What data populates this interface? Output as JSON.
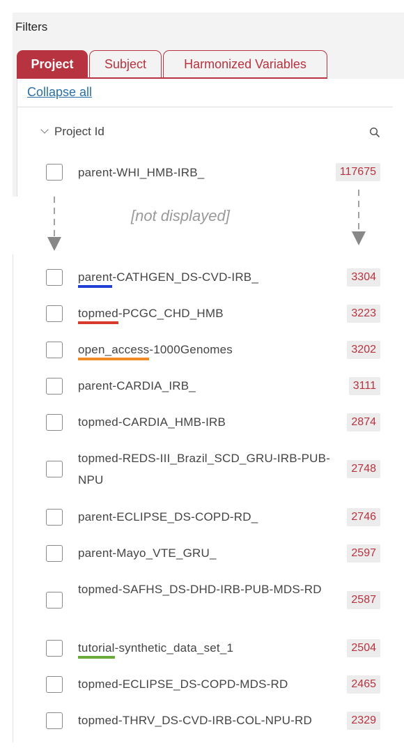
{
  "filters_title": "Filters",
  "tabs": [
    {
      "label": "Project",
      "active": true
    },
    {
      "label": "Subject",
      "active": false
    },
    {
      "label": "Harmonized Variables",
      "active": false
    }
  ],
  "collapse_all_label": "Collapse all",
  "field_header": {
    "label": "Project Id",
    "icons": [
      "chevron-down-icon",
      "search-icon"
    ]
  },
  "top_row": {
    "label": "parent-WHI_HMB-IRB_",
    "count": "117675"
  },
  "annotation": {
    "text": "[not displayed]"
  },
  "accent_colors": {
    "tab": "#b7333f",
    "link": "#2a6fa8"
  },
  "underline_colors": {
    "parent": "#1f3fd6",
    "topmed": "#d83a2b",
    "open_access": "#f08a24",
    "tutorial": "#6bab3a"
  },
  "rows": [
    {
      "prefix": "parent",
      "rest": "-CATHGEN_DS-CVD-IRB_",
      "count": "3304",
      "underline": "parent"
    },
    {
      "prefix": "topmed",
      "rest": "-PCGC_CHD_HMB",
      "count": "3223",
      "underline": "topmed"
    },
    {
      "prefix": "open_access",
      "rest": "-1000Genomes",
      "count": "3202",
      "underline": "open_access"
    },
    {
      "prefix": "",
      "rest": "parent-CARDIA_IRB_",
      "count": "3111",
      "underline": ""
    },
    {
      "prefix": "",
      "rest": "topmed-CARDIA_HMB-IRB",
      "count": "2874",
      "underline": ""
    },
    {
      "prefix": "",
      "rest": "topmed-REDS-III_Brazil_SCD_GRU-IRB-PUB-NPU",
      "count": "2748",
      "underline": ""
    },
    {
      "prefix": "",
      "rest": "parent-ECLIPSE_DS-COPD-RD_",
      "count": "2746",
      "underline": ""
    },
    {
      "prefix": "",
      "rest": "parent-Mayo_VTE_GRU_",
      "count": "2597",
      "underline": ""
    },
    {
      "prefix": "",
      "rest": "topmed-SAFHS_DS-DHD-IRB-PUB-MDS-RD",
      "count": "2587",
      "underline": ""
    },
    {
      "prefix": "tutorial",
      "rest": "-synthetic_data_set_1",
      "count": "2504",
      "underline": "tutorial"
    },
    {
      "prefix": "",
      "rest": "topmed-ECLIPSE_DS-COPD-MDS-RD",
      "count": "2465",
      "underline": ""
    },
    {
      "prefix": "",
      "rest": "topmed-THRV_DS-CVD-IRB-COL-NPU-RD",
      "count": "2329",
      "underline": ""
    }
  ]
}
